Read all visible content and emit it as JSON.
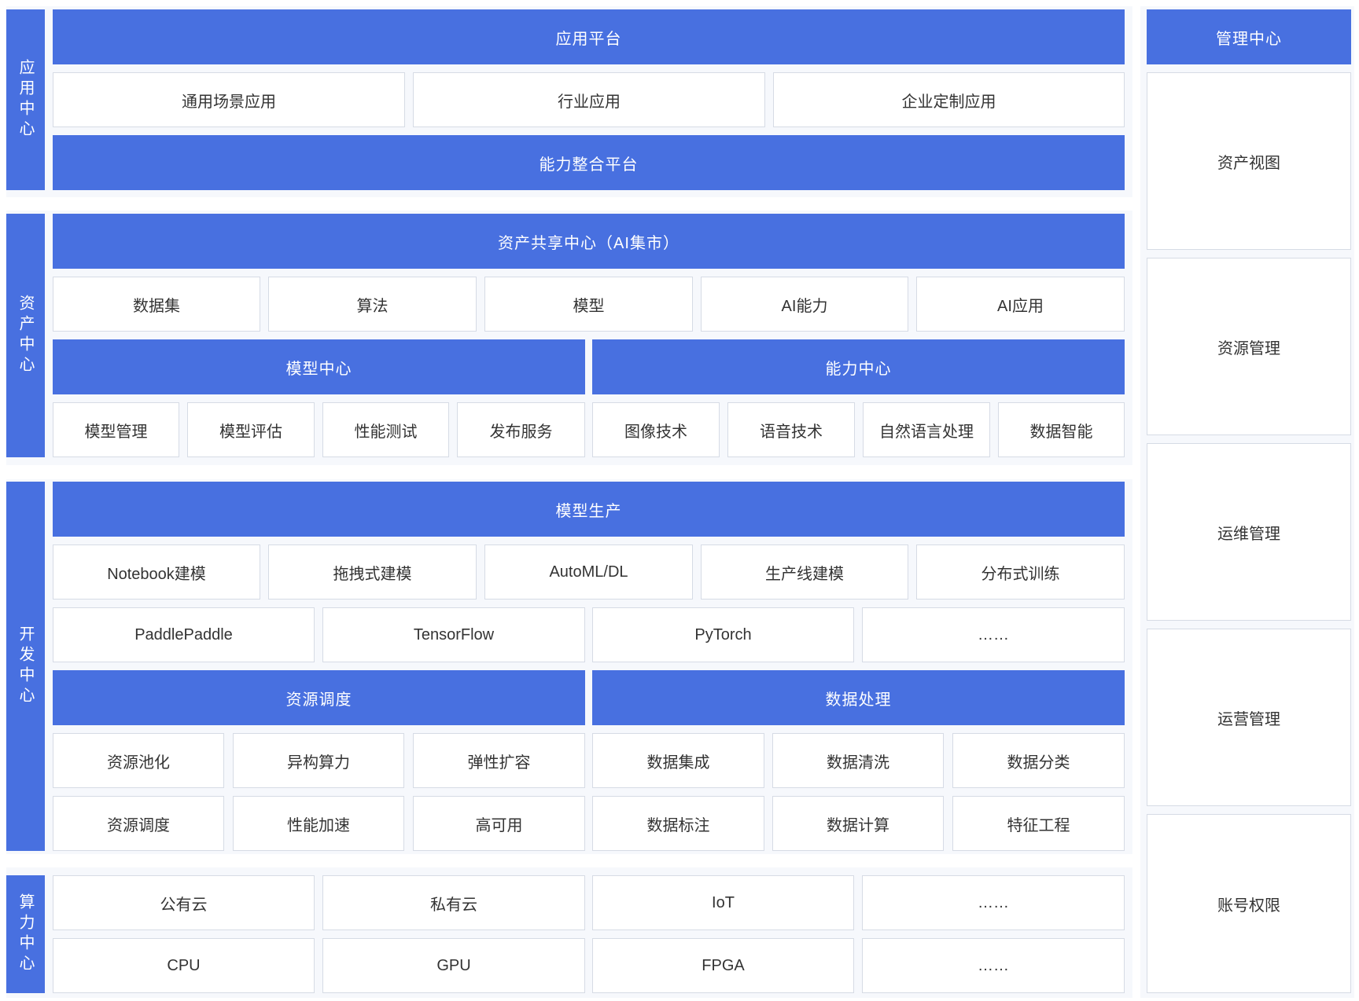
{
  "colors": {
    "accent": "#4870e0",
    "border": "#d6dbe5",
    "text": "#333333"
  },
  "app_center": {
    "label": "应用中心",
    "platform": "应用平台",
    "items": [
      "通用场景应用",
      "行业应用",
      "企业定制应用"
    ],
    "integration": "能力整合平台"
  },
  "asset_center": {
    "label": "资产中心",
    "sharing": "资产共享中心（AI集市）",
    "items": [
      "数据集",
      "算法",
      "模型",
      "AI能力",
      "AI应用"
    ],
    "model_center": "模型中心",
    "model_items": [
      "模型管理",
      "模型评估",
      "性能测试",
      "发布服务"
    ],
    "capability_center": "能力中心",
    "capability_items": [
      "图像技术",
      "语音技术",
      "自然语言处理",
      "数据智能"
    ]
  },
  "dev_center": {
    "label": "开发中心",
    "production": "模型生产",
    "modeling": [
      "Notebook建模",
      "拖拽式建模",
      "AutoML/DL",
      "生产线建模",
      "分布式训练"
    ],
    "frameworks": [
      "PaddlePaddle",
      "TensorFlow",
      "PyTorch",
      "……"
    ],
    "scheduling": "资源调度",
    "scheduling_items": [
      "资源池化",
      "异构算力",
      "弹性扩容",
      "资源调度",
      "性能加速",
      "高可用"
    ],
    "data_processing": "数据处理",
    "data_items": [
      "数据集成",
      "数据清洗",
      "数据分类",
      "数据标注",
      "数据计算",
      "特征工程"
    ]
  },
  "compute_center": {
    "label": "算力中心",
    "clouds": [
      "公有云",
      "私有云",
      "IoT",
      "……"
    ],
    "hardware": [
      "CPU",
      "GPU",
      "FPGA",
      "……"
    ]
  },
  "management": {
    "title": "管理中心",
    "items": [
      "资产视图",
      "资源管理",
      "运维管理",
      "运营管理",
      "账号权限"
    ]
  }
}
